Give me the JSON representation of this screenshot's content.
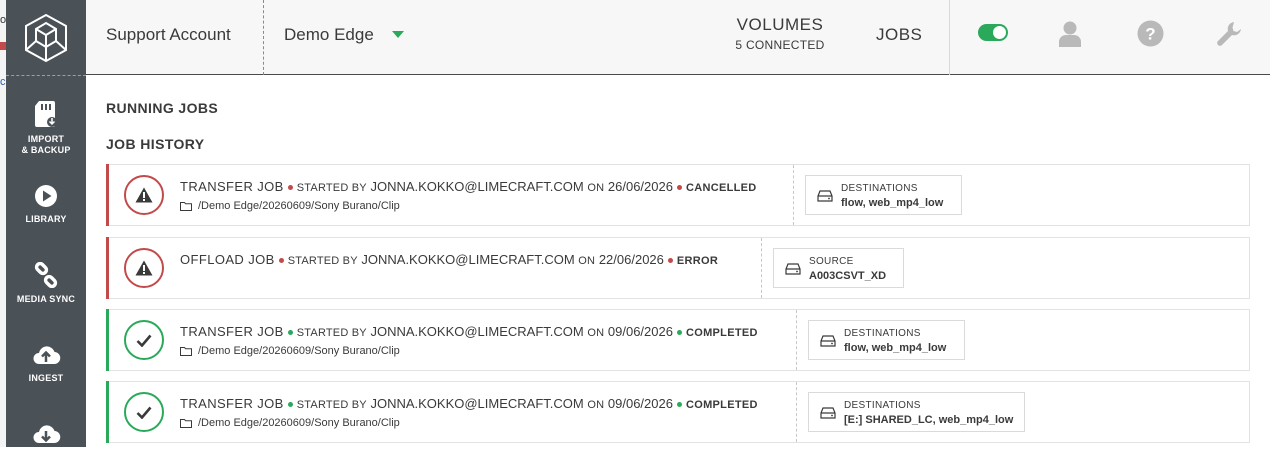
{
  "edge_fragments": [
    "ol",
    "c"
  ],
  "sidebar": {
    "items": [
      {
        "label": "IMPORT\n& BACKUP",
        "icon": "sd-card-icon"
      },
      {
        "label": "LIBRARY",
        "icon": "play-icon"
      },
      {
        "label": "MEDIA SYNC",
        "icon": "link-icon"
      },
      {
        "label": "INGEST",
        "icon": "cloud-upload-icon"
      },
      {
        "label": "",
        "icon": "cloud-download-icon"
      }
    ]
  },
  "header": {
    "account": "Support Account",
    "edge": "Demo Edge",
    "volumes_title": "VOLUMES",
    "volumes_sub": "5 CONNECTED",
    "jobs": "JOBS",
    "toggle_on": true
  },
  "sections": {
    "running": "RUNNING JOBS",
    "history": "JOB HISTORY"
  },
  "jobs": [
    {
      "type": "TRANSFER JOB",
      "started_by_label": "STARTED BY",
      "user": "JONNA.KOKKO@LIMECRAFT.COM",
      "on_label": "ON",
      "date": "26/06/2026",
      "status": "CANCELLED",
      "path": "/Demo Edge/20260609/Sony Burano/Clip",
      "box_label": "DESTINATIONS",
      "box_value": "flow, web_mp4_low"
    },
    {
      "type": "OFFLOAD JOB",
      "started_by_label": "STARTED BY",
      "user": "JONNA.KOKKO@LIMECRAFT.COM",
      "on_label": "ON",
      "date": "22/06/2026",
      "status": "ERROR",
      "path": "",
      "box_label": "SOURCE",
      "box_value": "A003CSVT_XD"
    },
    {
      "type": "TRANSFER JOB",
      "started_by_label": "STARTED BY",
      "user": "JONNA.KOKKO@LIMECRAFT.COM",
      "on_label": "ON",
      "date": "09/06/2026",
      "status": "COMPLETED",
      "path": "/Demo Edge/20260609/Sony Burano/Clip",
      "box_label": "DESTINATIONS",
      "box_value": "flow, web_mp4_low"
    },
    {
      "type": "TRANSFER JOB",
      "started_by_label": "STARTED BY",
      "user": "JONNA.KOKKO@LIMECRAFT.COM",
      "on_label": "ON",
      "date": "09/06/2026",
      "status": "COMPLETED",
      "path": "/Demo Edge/20260609/Sony Burano/Clip",
      "box_label": "DESTINATIONS",
      "box_value": "[E:] SHARED_LC, web_mp4_low"
    }
  ],
  "colors": {
    "sidebar": "#4a5157",
    "accent_green": "#2aa95a",
    "error_red": "#c24a4a"
  }
}
